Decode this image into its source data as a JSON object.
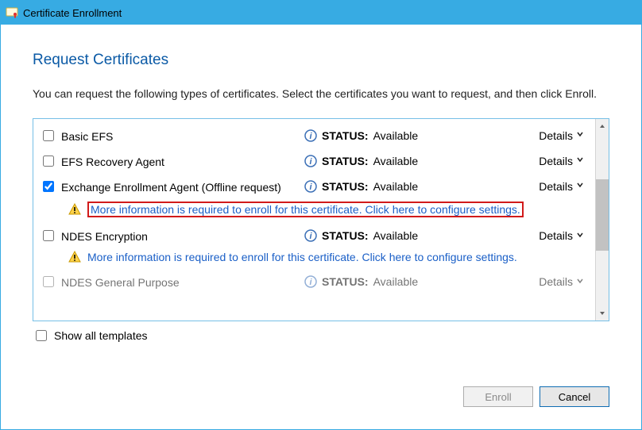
{
  "window": {
    "title": "Certificate Enrollment"
  },
  "section": {
    "title": "Request Certificates",
    "description": "You can request the following types of certificates. Select the certificates you want to request, and then click Enroll."
  },
  "status_labels": {
    "prefix": "STATUS:",
    "available": "Available"
  },
  "details_label": "Details",
  "info_message": "More information is required to enroll for this certificate. Click here to configure settings.",
  "templates": [
    {
      "name": "Basic EFS",
      "checked": false,
      "has_info": false,
      "highlighted": false
    },
    {
      "name": "EFS Recovery Agent",
      "checked": false,
      "has_info": false,
      "highlighted": false
    },
    {
      "name": "Exchange Enrollment Agent (Offline request)",
      "checked": true,
      "has_info": true,
      "highlighted": true
    },
    {
      "name": "NDES Encryption",
      "checked": false,
      "has_info": true,
      "highlighted": false
    },
    {
      "name": "NDES General Purpose",
      "checked": false,
      "has_info": false,
      "highlighted": false,
      "cutoff": true
    }
  ],
  "show_all": {
    "label": "Show all templates",
    "checked": false
  },
  "buttons": {
    "enroll": "Enroll",
    "cancel": "Cancel"
  }
}
